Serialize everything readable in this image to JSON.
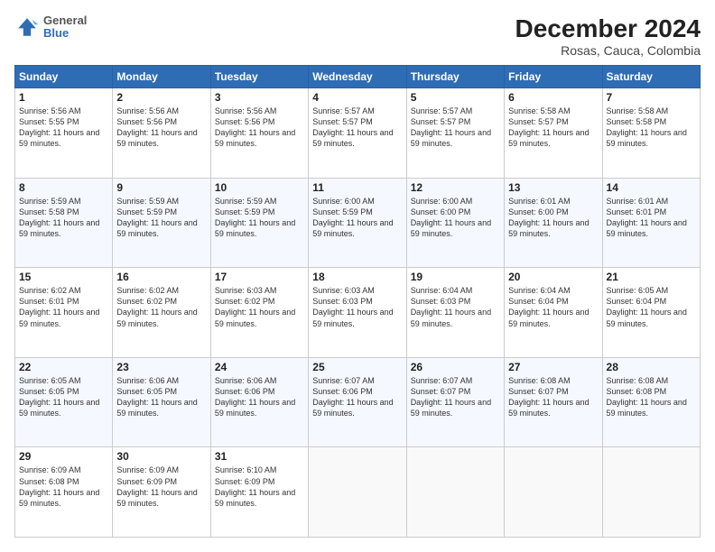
{
  "header": {
    "logo": {
      "general": "General",
      "blue": "Blue"
    },
    "title": "December 2024",
    "location": "Rosas, Cauca, Colombia"
  },
  "days_of_week": [
    "Sunday",
    "Monday",
    "Tuesday",
    "Wednesday",
    "Thursday",
    "Friday",
    "Saturday"
  ],
  "weeks": [
    [
      {
        "day": "1",
        "sunrise": "5:56 AM",
        "sunset": "5:55 PM",
        "daylight": "11 hours and 59 minutes."
      },
      {
        "day": "2",
        "sunrise": "5:56 AM",
        "sunset": "5:56 PM",
        "daylight": "11 hours and 59 minutes."
      },
      {
        "day": "3",
        "sunrise": "5:56 AM",
        "sunset": "5:56 PM",
        "daylight": "11 hours and 59 minutes."
      },
      {
        "day": "4",
        "sunrise": "5:57 AM",
        "sunset": "5:57 PM",
        "daylight": "11 hours and 59 minutes."
      },
      {
        "day": "5",
        "sunrise": "5:57 AM",
        "sunset": "5:57 PM",
        "daylight": "11 hours and 59 minutes."
      },
      {
        "day": "6",
        "sunrise": "5:58 AM",
        "sunset": "5:57 PM",
        "daylight": "11 hours and 59 minutes."
      },
      {
        "day": "7",
        "sunrise": "5:58 AM",
        "sunset": "5:58 PM",
        "daylight": "11 hours and 59 minutes."
      }
    ],
    [
      {
        "day": "8",
        "sunrise": "5:59 AM",
        "sunset": "5:58 PM",
        "daylight": "11 hours and 59 minutes."
      },
      {
        "day": "9",
        "sunrise": "5:59 AM",
        "sunset": "5:59 PM",
        "daylight": "11 hours and 59 minutes."
      },
      {
        "day": "10",
        "sunrise": "5:59 AM",
        "sunset": "5:59 PM",
        "daylight": "11 hours and 59 minutes."
      },
      {
        "day": "11",
        "sunrise": "6:00 AM",
        "sunset": "5:59 PM",
        "daylight": "11 hours and 59 minutes."
      },
      {
        "day": "12",
        "sunrise": "6:00 AM",
        "sunset": "6:00 PM",
        "daylight": "11 hours and 59 minutes."
      },
      {
        "day": "13",
        "sunrise": "6:01 AM",
        "sunset": "6:00 PM",
        "daylight": "11 hours and 59 minutes."
      },
      {
        "day": "14",
        "sunrise": "6:01 AM",
        "sunset": "6:01 PM",
        "daylight": "11 hours and 59 minutes."
      }
    ],
    [
      {
        "day": "15",
        "sunrise": "6:02 AM",
        "sunset": "6:01 PM",
        "daylight": "11 hours and 59 minutes."
      },
      {
        "day": "16",
        "sunrise": "6:02 AM",
        "sunset": "6:02 PM",
        "daylight": "11 hours and 59 minutes."
      },
      {
        "day": "17",
        "sunrise": "6:03 AM",
        "sunset": "6:02 PM",
        "daylight": "11 hours and 59 minutes."
      },
      {
        "day": "18",
        "sunrise": "6:03 AM",
        "sunset": "6:03 PM",
        "daylight": "11 hours and 59 minutes."
      },
      {
        "day": "19",
        "sunrise": "6:04 AM",
        "sunset": "6:03 PM",
        "daylight": "11 hours and 59 minutes."
      },
      {
        "day": "20",
        "sunrise": "6:04 AM",
        "sunset": "6:04 PM",
        "daylight": "11 hours and 59 minutes."
      },
      {
        "day": "21",
        "sunrise": "6:05 AM",
        "sunset": "6:04 PM",
        "daylight": "11 hours and 59 minutes."
      }
    ],
    [
      {
        "day": "22",
        "sunrise": "6:05 AM",
        "sunset": "6:05 PM",
        "daylight": "11 hours and 59 minutes."
      },
      {
        "day": "23",
        "sunrise": "6:06 AM",
        "sunset": "6:05 PM",
        "daylight": "11 hours and 59 minutes."
      },
      {
        "day": "24",
        "sunrise": "6:06 AM",
        "sunset": "6:06 PM",
        "daylight": "11 hours and 59 minutes."
      },
      {
        "day": "25",
        "sunrise": "6:07 AM",
        "sunset": "6:06 PM",
        "daylight": "11 hours and 59 minutes."
      },
      {
        "day": "26",
        "sunrise": "6:07 AM",
        "sunset": "6:07 PM",
        "daylight": "11 hours and 59 minutes."
      },
      {
        "day": "27",
        "sunrise": "6:08 AM",
        "sunset": "6:07 PM",
        "daylight": "11 hours and 59 minutes."
      },
      {
        "day": "28",
        "sunrise": "6:08 AM",
        "sunset": "6:08 PM",
        "daylight": "11 hours and 59 minutes."
      }
    ],
    [
      {
        "day": "29",
        "sunrise": "6:09 AM",
        "sunset": "6:08 PM",
        "daylight": "11 hours and 59 minutes."
      },
      {
        "day": "30",
        "sunrise": "6:09 AM",
        "sunset": "6:09 PM",
        "daylight": "11 hours and 59 minutes."
      },
      {
        "day": "31",
        "sunrise": "6:10 AM",
        "sunset": "6:09 PM",
        "daylight": "11 hours and 59 minutes."
      },
      null,
      null,
      null,
      null
    ]
  ]
}
